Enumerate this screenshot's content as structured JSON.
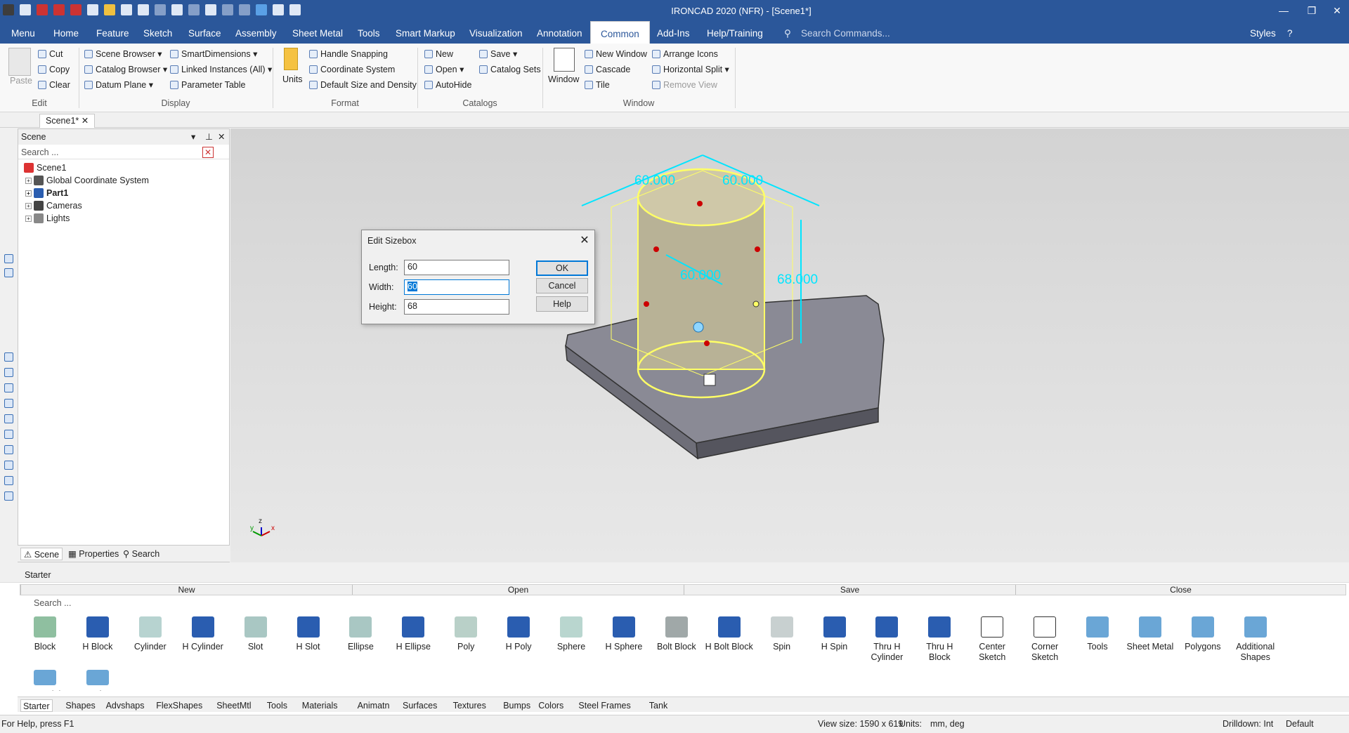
{
  "app": {
    "title": "IRONCAD 2020 (NFR) - [Scene1*]"
  },
  "menu": {
    "tabs": [
      "Menu",
      "Home",
      "Feature",
      "Sketch",
      "Surface",
      "Assembly",
      "Sheet Metal",
      "Tools",
      "Smart Markup",
      "Visualization",
      "Annotation",
      "Common",
      "Add-Ins",
      "Help/Training"
    ],
    "active": "Common",
    "search_placeholder": "Search Commands...",
    "styles_label": "Styles"
  },
  "ribbon": {
    "edit": {
      "paste": "Paste",
      "cut": "Cut",
      "copy": "Copy",
      "clear": "Clear",
      "group": "Edit"
    },
    "display": {
      "scene_browser": "Scene Browser",
      "catalog_browser": "Catalog Browser",
      "datum_plane": "Datum Plane",
      "smart_dimensions": "SmartDimensions",
      "linked_instances": "Linked Instances (All)",
      "parameter_table": "Parameter Table",
      "group": "Display"
    },
    "format": {
      "units": "Units",
      "handle_snapping": "Handle Snapping",
      "coordinate_system": "Coordinate System",
      "default_size": "Default Size and Density",
      "group": "Format"
    },
    "catalogs": {
      "new": "New",
      "open": "Open",
      "autohide": "AutoHide",
      "save": "Save",
      "catalog_sets": "Catalog Sets",
      "group": "Catalogs"
    },
    "window": {
      "window": "Window",
      "new_window": "New Window",
      "cascade": "Cascade",
      "tile": "Tile",
      "arrange_icons": "Arrange Icons",
      "horizontal_split": "Horizontal Split",
      "remove_view": "Remove View",
      "group": "Window"
    }
  },
  "doc_tab": "Scene1*",
  "scene_panel": {
    "title": "Scene",
    "search_placeholder": "Search ...",
    "tree": [
      "Scene1",
      "Global Coordinate System",
      "Part1",
      "Cameras",
      "Lights"
    ],
    "tabs": [
      "Scene",
      "Properties",
      "Search"
    ]
  },
  "viewport": {
    "dims": [
      "60.000",
      "60.000",
      "60.000",
      "68.000"
    ],
    "axis": {
      "x": "x",
      "y": "y",
      "z": "z"
    }
  },
  "dialog": {
    "title": "Edit Sizebox",
    "length_label": "Length:",
    "length": "60",
    "width_label": "Width:",
    "width": "60",
    "height_label": "Height:",
    "height": "68",
    "ok": "OK",
    "cancel": "Cancel",
    "help": "Help"
  },
  "starter": {
    "title": "Starter",
    "nav": [
      "New",
      "Open",
      "Save",
      "Close"
    ],
    "search_placeholder": "Search ...",
    "shapes": [
      "Block",
      "H Block",
      "Cylinder",
      "H Cylinder",
      "Slot",
      "H Slot",
      "Ellipse",
      "H Ellipse",
      "Poly",
      "H Poly",
      "Sphere",
      "H Sphere",
      "Bolt Block",
      "H Bolt Block",
      "Spin",
      "H Spin",
      "Thru H Cylinder",
      "Thru H Block",
      "Center Sketch",
      "Corner Sketch",
      "Tools",
      "Sheet Metal",
      "Polygons",
      "Additional Shapes"
    ],
    "row2": [
      "Material",
      "Setting"
    ]
  },
  "catalog_tabs": [
    "Starter",
    "Shapes",
    "Advshaps",
    "FlexShapes",
    "SheetMtl",
    "Tools",
    "Materials",
    "Animatn",
    "Surfaces",
    "Textures",
    "Bumps",
    "Colors",
    "Steel Frames",
    "Tank"
  ],
  "status": {
    "help": "For Help, press F1",
    "view_size": "View size: 1590 x  619",
    "units_label": "Units:",
    "units": "mm, deg",
    "drilldown": "Drilldown: Int",
    "default": "Default"
  },
  "colors": {
    "accent": "#2b579a",
    "dim": "#00e5ff",
    "sizebox": "#ffff66"
  }
}
